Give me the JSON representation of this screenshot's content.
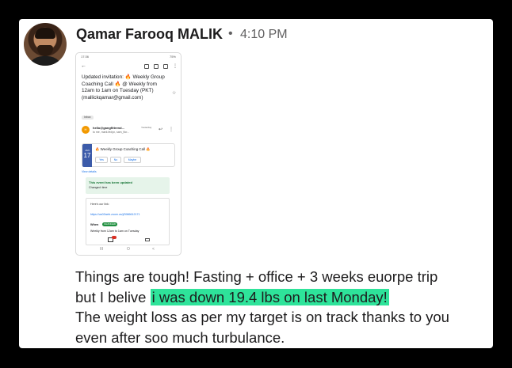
{
  "message": {
    "sender": "Qamar Farooq MALIK",
    "separator": "•",
    "time": "4:10 PM",
    "line1": "Things are tough! Fasting + office + 3 weeks euorpe trip",
    "line2_prefix": "but I belive ",
    "line2_highlight": "i was down 19.4 lbs on last Monday!",
    "line3": "The weight loss as per my target is on track thanks to you",
    "line4": "even after soo much turbulance."
  },
  "attachment": {
    "status_time": "17:36",
    "status_right": "75%",
    "subject": "Updated invitation: 🔥 Weekly Group Coaching Call 🔥 @ Weekly from 12am to 1am on Tuesday (PKT) (mallickqamar@gmail.com)",
    "inbox_label": "Inbox",
    "sender_initial": "H",
    "sender_email": "hello@gangfittrend...",
    "sender_when": "Yesterday",
    "sender_to": "to me, mark.fedyn, sam_flor...",
    "event_month": "JAN",
    "event_day": "17",
    "event_title": "🔥 Weekly Group Coaching Call 🔥",
    "btn_yes": "Yes",
    "btn_no": "No",
    "btn_maybe": "Maybe",
    "view_details": "View details",
    "updated_title": "This event has been updated",
    "updated_changed": "Changed: time",
    "body_heres": "Here's our link:",
    "body_link": "https://us02web.zoom.us/j/3986612171",
    "body_when": "When",
    "body_changed_chip": "CHANGED",
    "body_when_text": "Weekly from 12am to 1am on Tuesday",
    "sys_nav": [
      "III",
      "O",
      "<"
    ]
  }
}
